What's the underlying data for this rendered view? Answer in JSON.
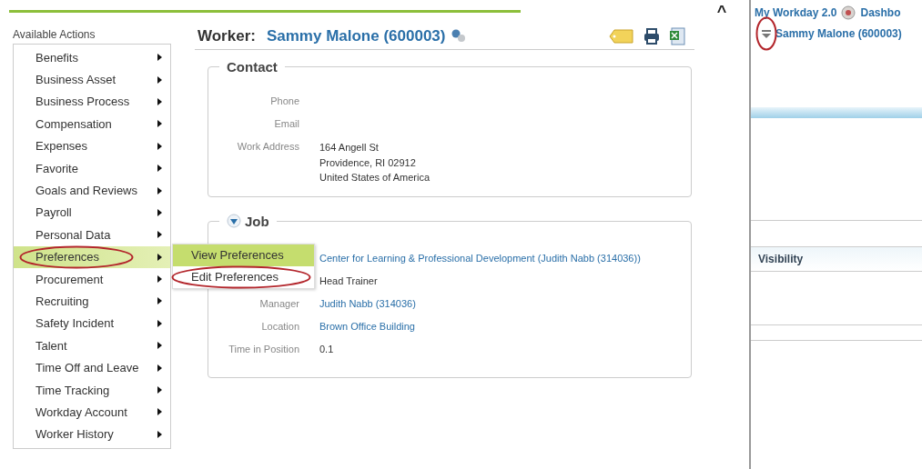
{
  "actions": {
    "title": "Available Actions",
    "items": [
      {
        "label": "Benefits",
        "selected": false,
        "circled": false
      },
      {
        "label": "Business Asset",
        "selected": false,
        "circled": false
      },
      {
        "label": "Business Process",
        "selected": false,
        "circled": false
      },
      {
        "label": "Compensation",
        "selected": false,
        "circled": false
      },
      {
        "label": "Expenses",
        "selected": false,
        "circled": false
      },
      {
        "label": "Favorite",
        "selected": false,
        "circled": false
      },
      {
        "label": "Goals and Reviews",
        "selected": false,
        "circled": false
      },
      {
        "label": "Payroll",
        "selected": false,
        "circled": false
      },
      {
        "label": "Personal Data",
        "selected": false,
        "circled": false
      },
      {
        "label": "Preferences",
        "selected": true,
        "circled": true,
        "submenu": [
          {
            "label": "View Preferences",
            "selected": true,
            "circled": false
          },
          {
            "label": "Edit Preferences",
            "selected": false,
            "circled": true
          }
        ]
      },
      {
        "label": "Procurement",
        "selected": false,
        "circled": false
      },
      {
        "label": "Recruiting",
        "selected": false,
        "circled": false
      },
      {
        "label": "Safety Incident",
        "selected": false,
        "circled": false
      },
      {
        "label": "Talent",
        "selected": false,
        "circled": false
      },
      {
        "label": "Time Off and Leave",
        "selected": false,
        "circled": false
      },
      {
        "label": "Time Tracking",
        "selected": false,
        "circled": false
      },
      {
        "label": "Workday Account",
        "selected": false,
        "circled": false
      },
      {
        "label": "Worker History",
        "selected": false,
        "circled": false
      }
    ]
  },
  "worker": {
    "prefix": "Worker:",
    "name": "Sammy Malone (600003)"
  },
  "contact": {
    "title": "Contact",
    "rows": [
      {
        "label": "Phone"
      },
      {
        "label": "Email"
      },
      {
        "label": "Work Address",
        "lines": [
          "164 Angell St",
          "Providence, RI 02912",
          "United States of America"
        ]
      }
    ]
  },
  "job": {
    "title": "Job",
    "expanded": true,
    "rows": [
      {
        "value": "Center for Learning & Professional Development (Judith Nabb (314036))",
        "kind": "link"
      },
      {
        "value": "Head Trainer",
        "kind": "text"
      },
      {
        "label": "Manager",
        "value": "Judith Nabb (314036)",
        "kind": "link"
      },
      {
        "label": "Location",
        "value": "Brown Office Building",
        "kind": "link"
      },
      {
        "label": "Time in Position",
        "value": "0.1",
        "kind": "text"
      }
    ]
  },
  "side_panel": {
    "collapse_mark": "^",
    "app": "My Workday 2.0",
    "dashboard": "Dashbo",
    "worker": "Sammy Malone (600003)",
    "worker_icon_circled": true,
    "section": "Visibility"
  }
}
